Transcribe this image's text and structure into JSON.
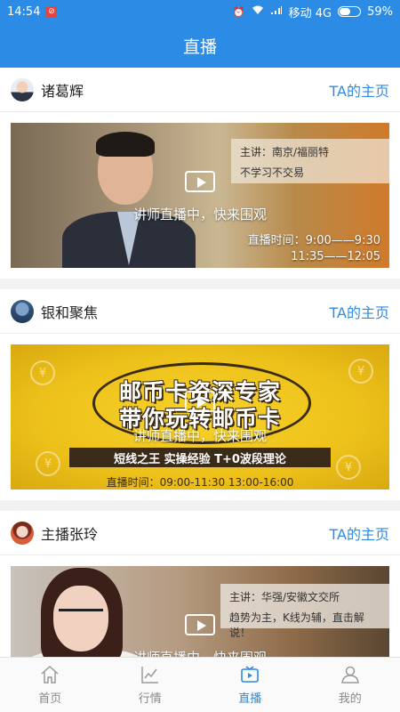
{
  "status_bar": {
    "time": "14:54",
    "carrier": "移动 4G",
    "battery": "59%",
    "battery_level": 0.59
  },
  "header": {
    "title": "直播"
  },
  "streams": [
    {
      "host": "诸葛辉",
      "home_link": "TA的主页",
      "lecturer": "主讲：南京/福丽特",
      "slogan": "不学习不交易",
      "live_text": "讲师直播中，快来围观",
      "time_line1": "直播时间：9:00——9:30",
      "time_line2": "11:35——12:05"
    },
    {
      "host": "银和聚焦",
      "home_link": "TA的主页",
      "headline1": "邮币卡资深专家",
      "headline2": "带你玩转邮币卡",
      "strip": "短线之王 实操经验 T+0波段理论",
      "live_text": "讲师直播中，快来围观",
      "time_line": "直播时间：09:00-11:30     13:00-16:00"
    },
    {
      "host": "主播张玲",
      "home_link": "TA的主页",
      "lecturer": "主讲：华强/安徽文交所",
      "slogan": "趋势为主，K线为辅，直击解说！",
      "live_text": "讲师直播中，快来围观"
    }
  ],
  "tabbar": {
    "items": [
      {
        "label": "首页",
        "icon": "home-icon"
      },
      {
        "label": "行情",
        "icon": "chart-icon"
      },
      {
        "label": "直播",
        "icon": "tv-icon"
      },
      {
        "label": "我的",
        "icon": "user-icon"
      }
    ],
    "active": "直播"
  },
  "colors": {
    "primary": "#2c8be4"
  }
}
